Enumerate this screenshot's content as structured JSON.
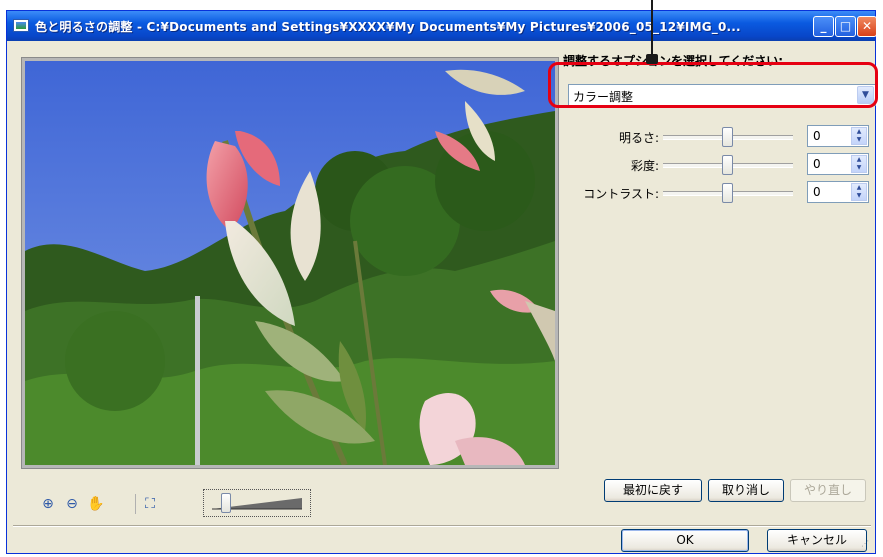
{
  "window": {
    "title": "色と明るさの調整 - C:¥Documents and Settings¥XXXX¥My Documents¥My Pictures¥2006_05_12¥IMG_0...",
    "minimize_glyph": "_",
    "maximize_glyph": "□",
    "close_glyph": "✕"
  },
  "options": {
    "label": "調整するオプションを選択してください:",
    "selected": "カラー調整"
  },
  "adjustments": [
    {
      "label": "明るさ:",
      "value": "0",
      "level": 0.5
    },
    {
      "label": "彩度:",
      "value": "0",
      "level": 0.5
    },
    {
      "label": "コントラスト:",
      "value": "0",
      "level": 0.5
    }
  ],
  "toolbar": {
    "icons": [
      "zoom-in-icon",
      "zoom-out-icon",
      "hand-pan-icon",
      "fit-to-window-icon"
    ],
    "zoom_level": 0.15
  },
  "buttons": {
    "reset": "最初に戻す",
    "undo": "取り消し",
    "redo": "やり直し",
    "ok": "OK",
    "cancel": "キャンセル"
  },
  "colors": {
    "highlight": "#e60012",
    "titlebar": "#0a5ae0",
    "sky": "#4f78d8"
  }
}
